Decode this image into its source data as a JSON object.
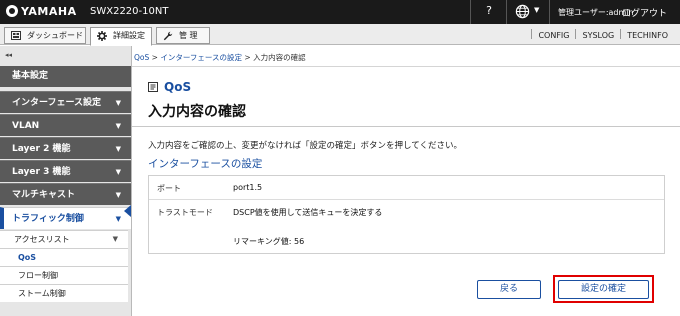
{
  "header": {
    "brand": "YAMAHA",
    "model": "SWX2220-10NT",
    "help": "?",
    "admin_label": "管理ユーザー:admin",
    "logout": "ログアウト"
  },
  "tabs": [
    {
      "label": "ダッシュボード",
      "icon": "dashboard-icon"
    },
    {
      "label": "詳細設定",
      "icon": "gear-icon"
    },
    {
      "label": "管 理",
      "icon": "wrench-icon"
    }
  ],
  "right_links": [
    "CONFIG",
    "SYSLOG",
    "TECHINFO"
  ],
  "sidebar": {
    "collapse": "◂◂",
    "home": "基本設定",
    "items": [
      {
        "label": "インターフェース設定"
      },
      {
        "label": "VLAN"
      },
      {
        "label": "Layer 2 機能"
      },
      {
        "label": "Layer 3 機能"
      },
      {
        "label": "マルチキャスト"
      },
      {
        "label": "トラフィック制御"
      }
    ],
    "sub_items": [
      {
        "label": "アクセスリスト"
      },
      {
        "label": "QoS"
      },
      {
        "label": "フロー制御"
      },
      {
        "label": "ストーム制御"
      }
    ]
  },
  "breadcrumb": {
    "part1": "QoS",
    "sep": " > ",
    "part2": "インターフェースの設定",
    "part3": "入力内容の確認"
  },
  "section_title": "QoS",
  "page_title": "入力内容の確認",
  "description": "入力内容をご確認の上、変更がなければ「設定の確定」ボタンを押してください。",
  "subheading": "インターフェースの設定",
  "table": {
    "rows": [
      {
        "label": "ポート",
        "value": "port1.5"
      },
      {
        "label": "トラストモード",
        "value": "DSCP値を使用して送信キューを決定する",
        "value2": "リマーキング値: 56"
      }
    ]
  },
  "buttons": {
    "back": "戻る",
    "confirm": "設定の確定"
  },
  "colors": {
    "accent": "#1a4fa0",
    "highlight": "#e00000",
    "nav_bg": "#5a5a5a"
  }
}
